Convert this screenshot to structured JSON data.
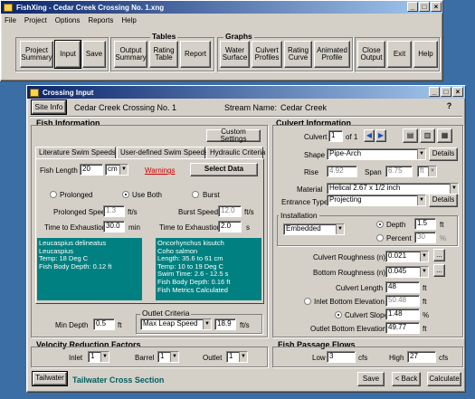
{
  "app": {
    "title": "FishXing - Cedar Creek Crossing No. 1.xng",
    "menu": [
      "File",
      "Project",
      "Options",
      "Reports",
      "Help"
    ],
    "groups": {
      "tables": "Tables",
      "graphs": "Graphs"
    },
    "toolbar": {
      "project_summary": "Project Summary",
      "input": "Input",
      "save": "Save",
      "output_summary": "Output Summary",
      "rating_table": "Rating Table",
      "report": "Report",
      "water_surface": "Water Surface",
      "culvert_profiles": "Culvert Profiles",
      "rating_curve": "Rating Curve",
      "animated_profile": "Animated Profile",
      "close_output": "Close Output",
      "exit": "Exit",
      "help": "Help"
    }
  },
  "dialog": {
    "title": "Crossing Input",
    "site_info": "Site Info",
    "crossing_name": "Cedar Creek Crossing No. 1",
    "stream_label": "Stream Name:",
    "stream_name": "Cedar Creek",
    "fish": {
      "header": "Fish Information",
      "custom_settings": "Custom Settings",
      "tabs": [
        "Literature Swim Speeds",
        "User-defined Swim Speeds",
        "Hydraulic Criteria"
      ],
      "fish_length_label": "Fish Length",
      "fish_length": "20",
      "unit_cm": "cm",
      "warnings": "Warnings",
      "select_data": "Select Data",
      "prolonged": "Prolonged",
      "use_both": "Use Both",
      "burst": "Burst",
      "prolonged_speed_label": "Prolonged Speed",
      "prolonged_speed": "1.3",
      "ft_s": "ft/s",
      "burst_speed_label": "Burst Speed",
      "burst_speed": "12.0",
      "tte_label": "Time to Exhaustion",
      "tte_prolonged": "30.0",
      "min": "min",
      "tte_burst": "2.0",
      "s": "s",
      "left_info": "Leucaspius delineatus\nLeucaspius\nTemp: 18 Deg C\nFish Body Depth: 0.12 ft",
      "right_info": "Oncorhynchus kisutch\nCoho salmon\nLength: 35.6 to 61 cm\nTemp: 10 to 19 Deg C\nSwim Time: 2.6 - 12.5 s\nFish Body Depth: 0.16 ft\nFish Metrics Calculated",
      "outlet_criteria": "Outlet Criteria",
      "min_depth_label": "Min  Depth",
      "min_depth": "0.5",
      "ft": "ft",
      "leap_speed": "Max Leap Speed",
      "leap_value": "18.9"
    },
    "culvert": {
      "header": "Culvert Information",
      "culvert_label": "Culvert",
      "culvert_num": "1",
      "of": "of 1",
      "shape_label": "Shape",
      "shape": "Pipe-Arch",
      "details": "Details",
      "rise_label": "Rise",
      "rise": "4.92",
      "span_label": "Span",
      "span": "6.75",
      "ft": "ft",
      "material_label": "Material",
      "material": "Helical 2.67 x 1/2 inch",
      "entrance_label": "Entrance Type",
      "entrance": "Projecting",
      "installation": "Installation",
      "embedded": "Embedded",
      "depth_label": "Depth",
      "depth": "1.5",
      "percent_label": "Percent",
      "percent": "30",
      "pct": "%",
      "roughness_label": "Culvert Roughness (n)",
      "roughness": "0.021",
      "bottom_roughness_label": "Bottom Roughness (n)",
      "bottom_roughness": "0.045",
      "length_label": "Culvert Length",
      "length": "48",
      "inlet_elev_label": "Inlet Bottom Elevation",
      "inlet_elev": "50.48",
      "slope_label": "Culvert Slope",
      "slope": "1.48",
      "outlet_elev_label": "Outlet Bottom Elevation",
      "outlet_elev": "49.77",
      "ellipsis": "..."
    },
    "velocity": {
      "header": "Velocity Reduction Factors",
      "inlet": "Inlet",
      "inlet_v": "1",
      "barrel": "Barrel",
      "barrel_v": "1",
      "outlet": "Outlet",
      "outlet_v": "1"
    },
    "flows": {
      "header": "Fish Passage Flows",
      "low_label": "Low",
      "low": "3",
      "high_label": "High",
      "high": "27",
      "cfs": "cfs"
    },
    "tailwater_btn": "Tailwater",
    "tailwater_label": "Tailwater Cross Section",
    "save": "Save",
    "back": "< Back",
    "calculate": "Calculate"
  }
}
